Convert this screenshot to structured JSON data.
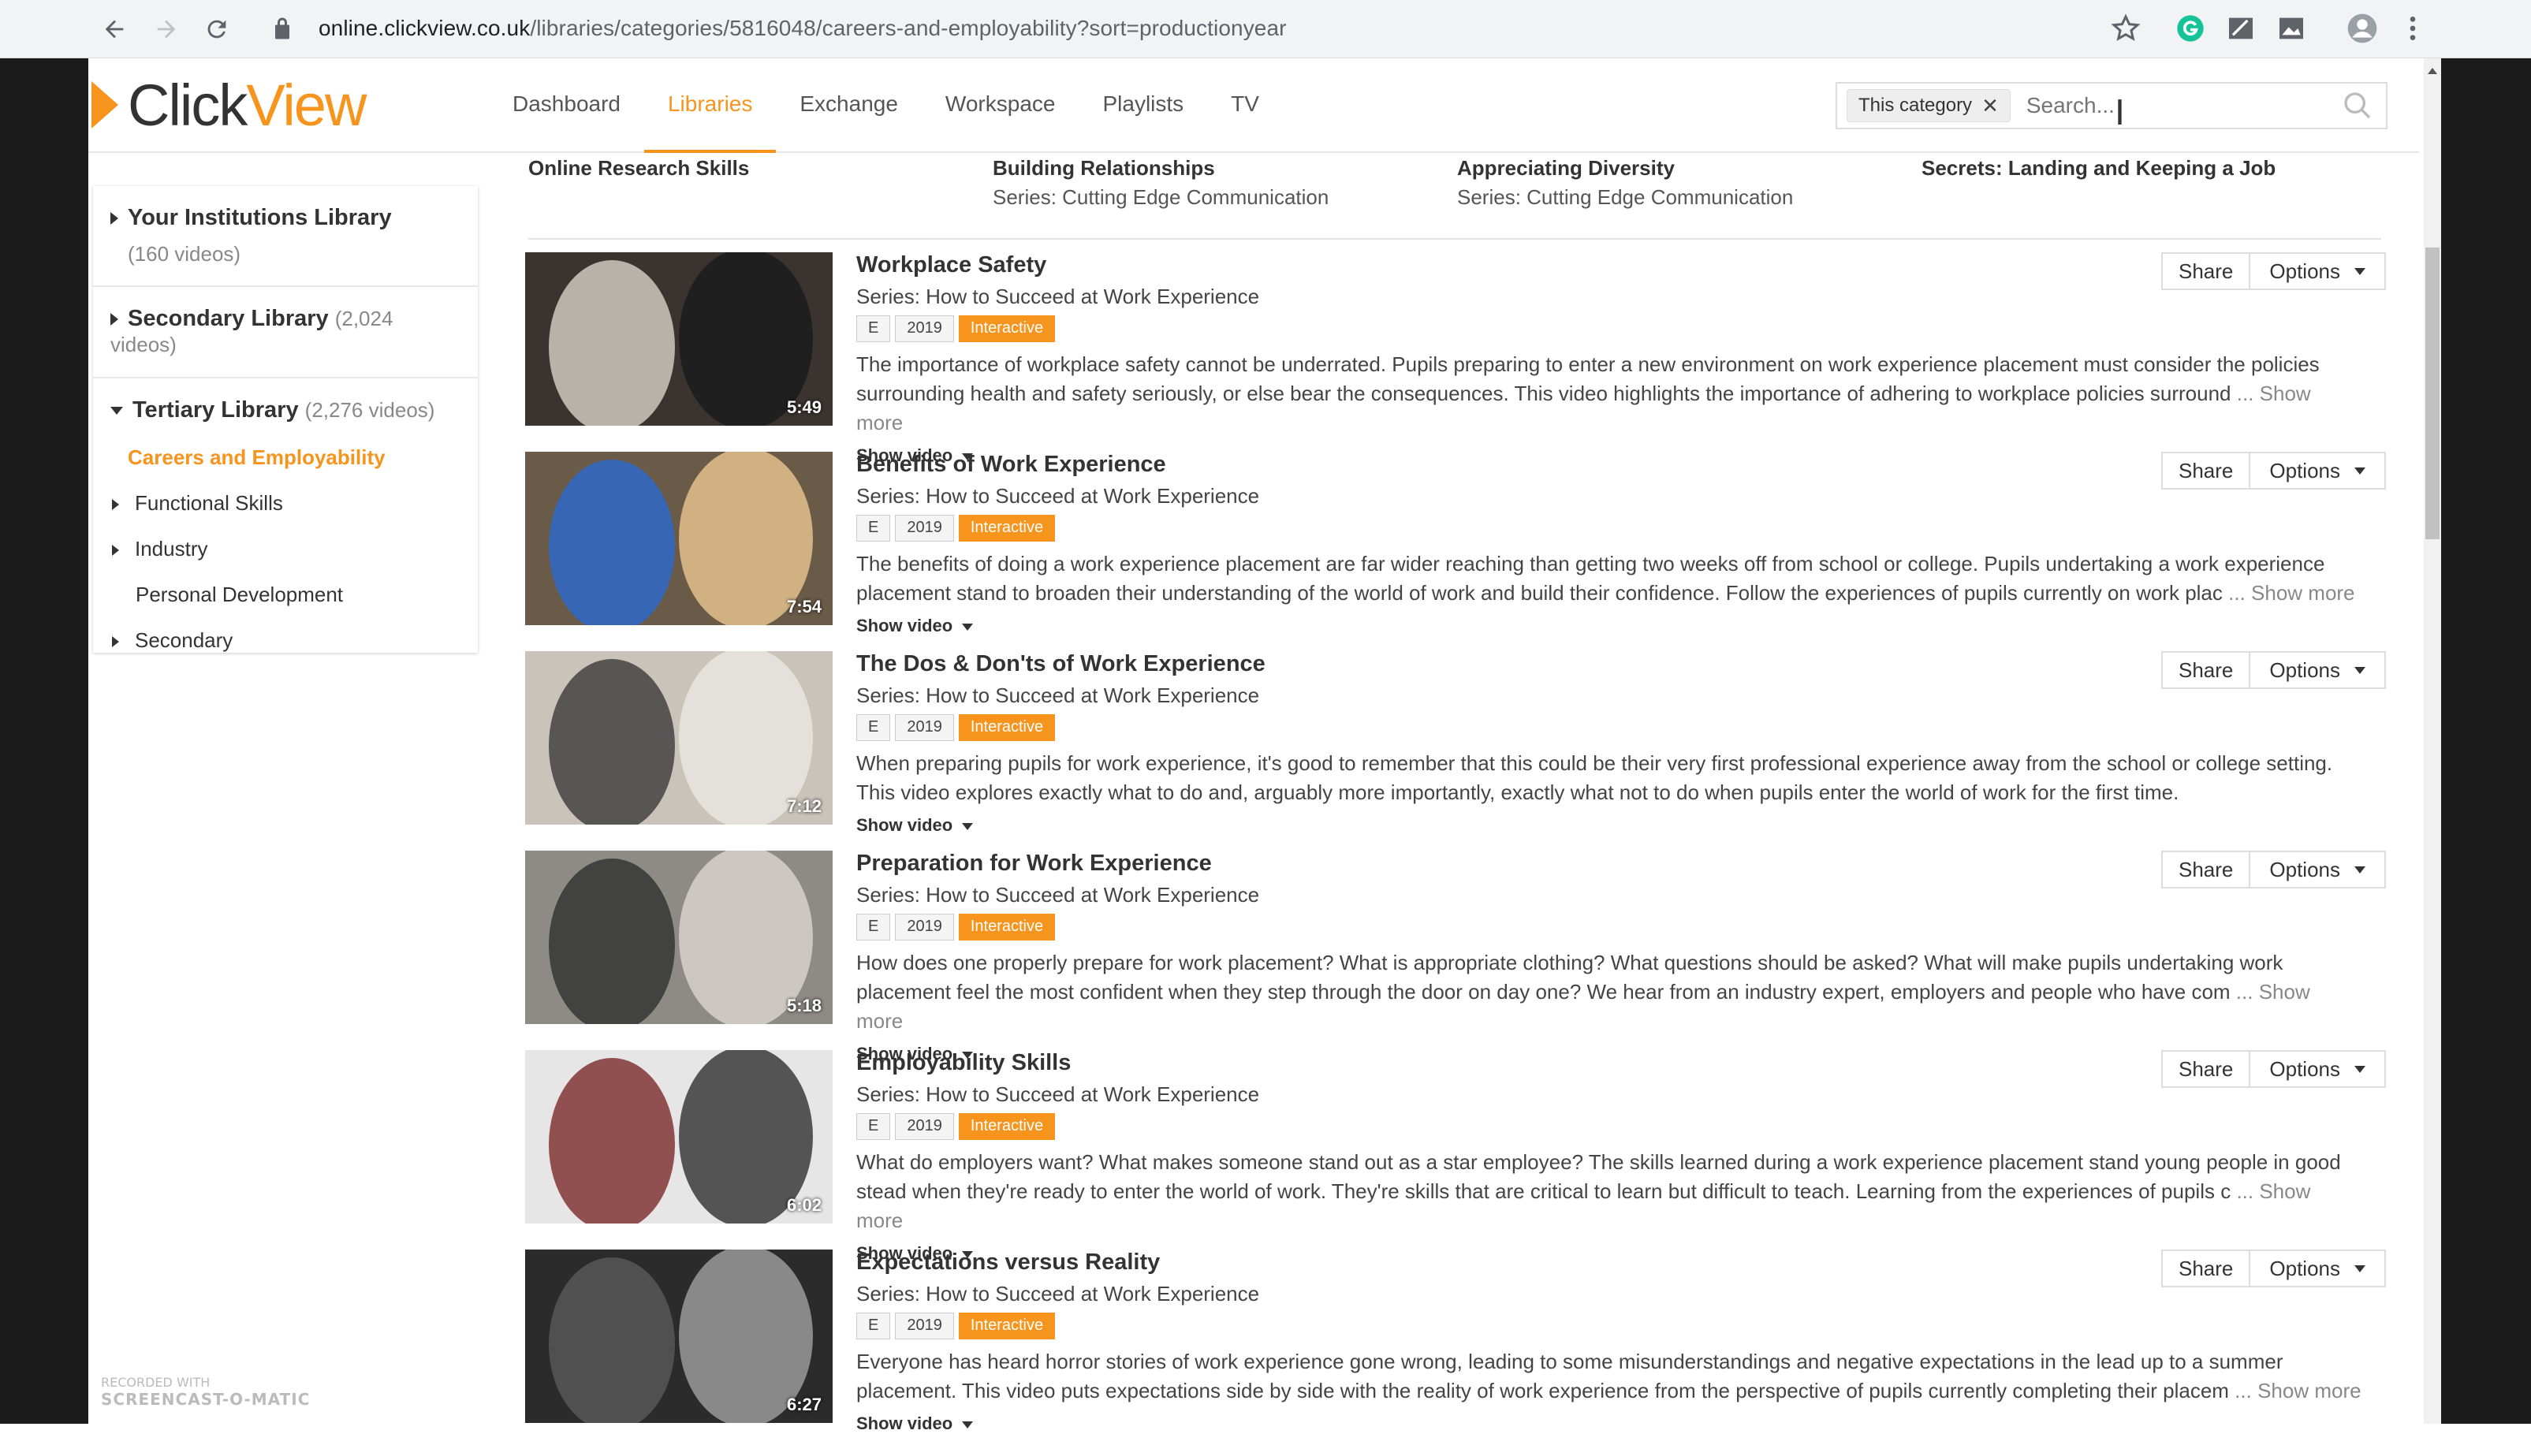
{
  "browser": {
    "url_host": "online.clickview.co.uk",
    "url_path": "/libraries/categories/5816048/careers-and-employability?sort=productionyear"
  },
  "header": {
    "logo_text_a": "Click",
    "logo_text_b": "View",
    "nav": [
      "Dashboard",
      "Libraries",
      "Exchange",
      "Workspace",
      "Playlists",
      "TV"
    ],
    "active_nav": "Libraries",
    "search_chip": "This category",
    "search_placeholder": "Search..."
  },
  "sidebar": {
    "libraries": [
      {
        "name": "Your Institutions Library",
        "count": "(160 videos)"
      },
      {
        "name": "Secondary Library",
        "count": "(2,024 videos)"
      },
      {
        "name": "Tertiary Library",
        "count": "(2,276 videos)"
      }
    ],
    "categories": [
      {
        "label": "Careers and Employability",
        "active": true
      },
      {
        "label": "Functional Skills"
      },
      {
        "label": "Industry"
      },
      {
        "label": "Personal Development"
      },
      {
        "label": "Secondary"
      }
    ]
  },
  "series_row": [
    {
      "title": "Online Research Skills",
      "series": ""
    },
    {
      "title": "Building Relationships",
      "series": "Series: Cutting Edge Communication"
    },
    {
      "title": "Appreciating Diversity",
      "series": "Series: Cutting Edge Communication"
    },
    {
      "title": "Secrets: Landing and Keeping a Job",
      "series": ""
    }
  ],
  "labels": {
    "share": "Share",
    "options": "Options",
    "show_video": "Show video",
    "show_more": "... Show more",
    "tag_e": "E",
    "tag_interactive": "Interactive"
  },
  "videos": [
    {
      "title": "Workplace Safety",
      "series": "Series: How to Succeed at Work Experience",
      "year": "2019",
      "duration": "5:49",
      "description": "The importance of workplace safety cannot be underrated. Pupils preparing to enter a new environment on work experience placement must consider the policies surrounding health and safety seriously, or else bear the consequences. This video highlights the importance of adhering to workplace policies surround",
      "truncated": true
    },
    {
      "title": "Benefits of Work Experience",
      "series": "Series: How to Succeed at Work Experience",
      "year": "2019",
      "duration": "7:54",
      "description": "The benefits of doing a work experience placement are far wider reaching than getting two weeks off from school or college. Pupils undertaking a work experience placement stand to broaden their understanding of the world of work and build their confidence. Follow the experiences of pupils currently on work plac",
      "truncated": true
    },
    {
      "title": "The Dos & Don'ts of Work Experience",
      "series": "Series: How to Succeed at Work Experience",
      "year": "2019",
      "duration": "7:12",
      "description": "When preparing pupils for work experience, it's good to remember that this could be their very first professional experience away from the school or college setting. This video explores exactly what to do and, arguably more importantly, exactly what not to do when pupils enter the world of work for the first time.",
      "truncated": false
    },
    {
      "title": "Preparation for Work Experience",
      "series": "Series: How to Succeed at Work Experience",
      "year": "2019",
      "duration": "5:18",
      "description": "How does one properly prepare for work placement? What is appropriate clothing? What questions should be asked? What will make pupils undertaking work placement feel the most confident when they step through the door on day one? We hear from an industry expert, employers and people who have com",
      "truncated": true
    },
    {
      "title": "Employability Skills",
      "series": "Series: How to Succeed at Work Experience",
      "year": "2019",
      "duration": "6:02",
      "description": "What do employers want? What makes someone stand out as a star employee? The skills learned during a work experience placement stand young people in good stead when they're ready to enter the world of work. They're skills that are critical to learn but difficult to teach. Learning from the experiences of pupils c",
      "truncated": true
    },
    {
      "title": "Expectations versus Reality",
      "series": "Series: How to Succeed at Work Experience",
      "year": "2019",
      "duration": "6:27",
      "description": "Everyone has heard horror stories of work experience gone wrong, leading to some misunderstandings and negative expectations in the lead up to a summer placement. This video puts expectations side by side with the reality of work experience from the perspective of pupils currently completing their placem",
      "truncated": true
    }
  ],
  "watermark": {
    "line1": "RECORDED WITH",
    "line2": "SCREENCAST-O-MATIC"
  }
}
